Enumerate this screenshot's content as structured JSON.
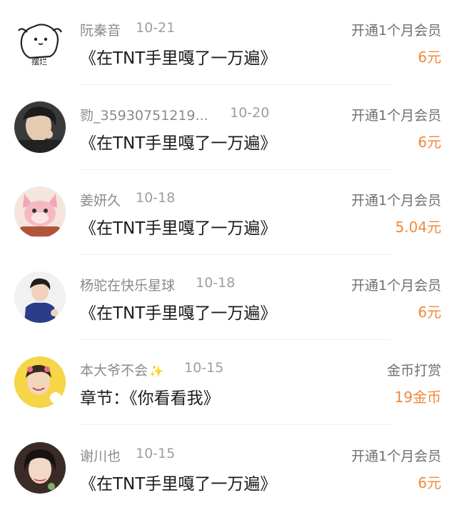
{
  "rows": [
    {
      "name": "阮秦音",
      "date": "10-21",
      "content": "《在TNT手里嘎了一万遍》",
      "type": "开通1个月会员",
      "amount": "6元",
      "avatar_text": "摆烂"
    },
    {
      "name": "勠_35930751219...",
      "date": "10-20",
      "content": "《在TNT手里嘎了一万遍》",
      "type": "开通1个月会员",
      "amount": "6元"
    },
    {
      "name": "姜妍久",
      "date": "10-18",
      "content": "《在TNT手里嘎了一万遍》",
      "type": "开通1个月会员",
      "amount": "5.04元"
    },
    {
      "name": "杨驼在快乐星球",
      "date": "10-18",
      "content": "《在TNT手里嘎了一万遍》",
      "type": "开通1个月会员",
      "amount": "6元"
    },
    {
      "name": "本大爷不会",
      "date": "10-15",
      "content": "章节：《你看看我》",
      "type": "金币打赏",
      "amount": "19金币"
    },
    {
      "name": "谢川也",
      "date": "10-15",
      "content": "《在TNT手里嘎了一万遍》",
      "type": "开通1个月会员",
      "amount": "6元"
    }
  ],
  "colors": {
    "amount": "#f0883e",
    "name": "#8a8a8a",
    "type": "#6f6f6f"
  }
}
